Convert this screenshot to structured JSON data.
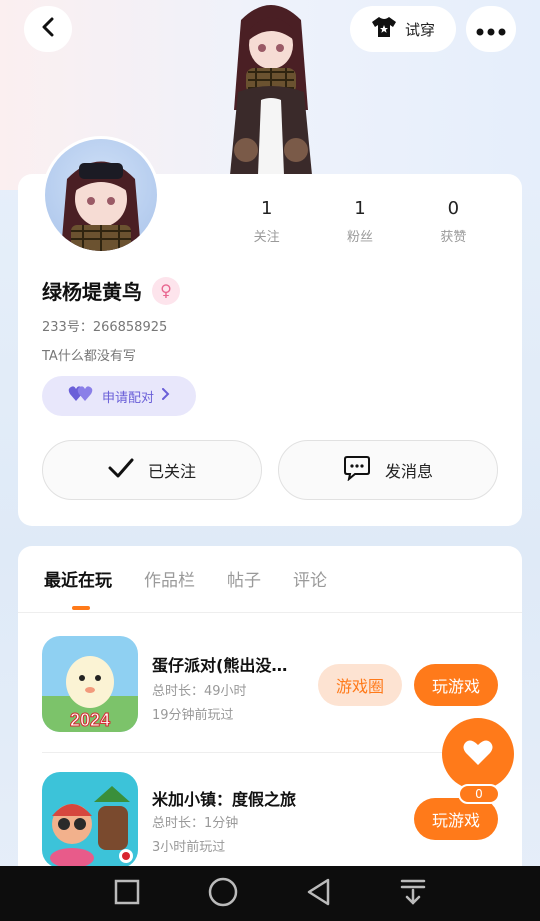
{
  "header": {
    "tryon_label": "试穿"
  },
  "profile": {
    "name": "绿杨堤黄鸟",
    "uid": "233号：266858925",
    "bio": "TA什么都没有写",
    "match_label": "申请配对",
    "stats": [
      {
        "value": "1",
        "label": "关注"
      },
      {
        "value": "1",
        "label": "粉丝"
      },
      {
        "value": "0",
        "label": "获赞"
      }
    ],
    "follow_label": "已关注",
    "message_label": "发消息"
  },
  "tabs": [
    {
      "label": "最近在玩"
    },
    {
      "label": "作品栏"
    },
    {
      "label": "帖子"
    },
    {
      "label": "评论"
    }
  ],
  "games": [
    {
      "title": "蛋仔派对(熊出没…",
      "duration": "总时长：49小时",
      "last_played": "19分钟前玩过",
      "circle_label": "游戏圈",
      "play_label": "玩游戏"
    },
    {
      "title": "米加小镇：度假之旅",
      "duration": "总时长：1分钟",
      "last_played": "3小时前玩过",
      "play_label": "玩游戏"
    }
  ],
  "fab": {
    "count": "0"
  },
  "colors": {
    "accent": "#ff7a1a",
    "match": "#6a5fd8",
    "gender": "#e8668f"
  }
}
